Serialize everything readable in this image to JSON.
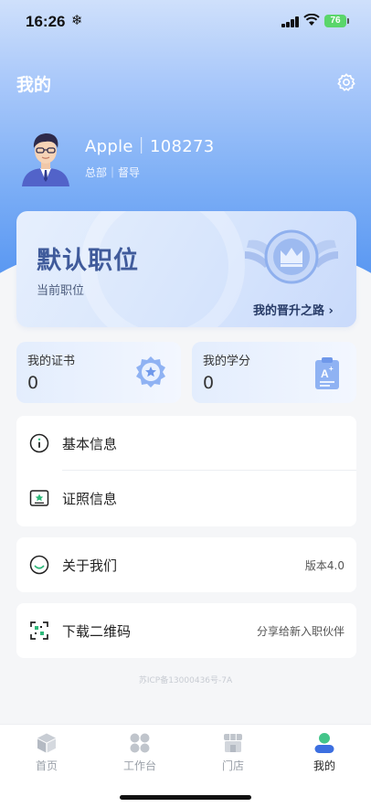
{
  "status_bar": {
    "time": "16:26",
    "extra_icon": "❄",
    "battery": "76"
  },
  "header": {
    "title": "我的"
  },
  "user": {
    "name_line": "Apple｜108273",
    "sub_line": "总部｜督导"
  },
  "position_card": {
    "title": "默认职位",
    "subtitle": "当前职位",
    "link": "我的晋升之路 ›"
  },
  "stats": [
    {
      "label": "我的证书",
      "value": "0"
    },
    {
      "label": "我的学分",
      "value": "0"
    }
  ],
  "menu": {
    "basic_info": "基本信息",
    "license_info": "证照信息",
    "about": "关于我们",
    "version": "版本4.0",
    "download_qr": "下载二维码",
    "share": "分享给新入职伙伴"
  },
  "icp": "苏ICP备13000436号-7A",
  "tabs": [
    {
      "label": "首页",
      "icon": "cube-icon"
    },
    {
      "label": "工作台",
      "icon": "grid-icon"
    },
    {
      "label": "门店",
      "icon": "store-icon"
    },
    {
      "label": "我的",
      "icon": "person-icon",
      "active": true
    }
  ],
  "colors": {
    "accent": "#5a98f2",
    "active_green": "#43c58a",
    "card_title": "#405b9b"
  }
}
